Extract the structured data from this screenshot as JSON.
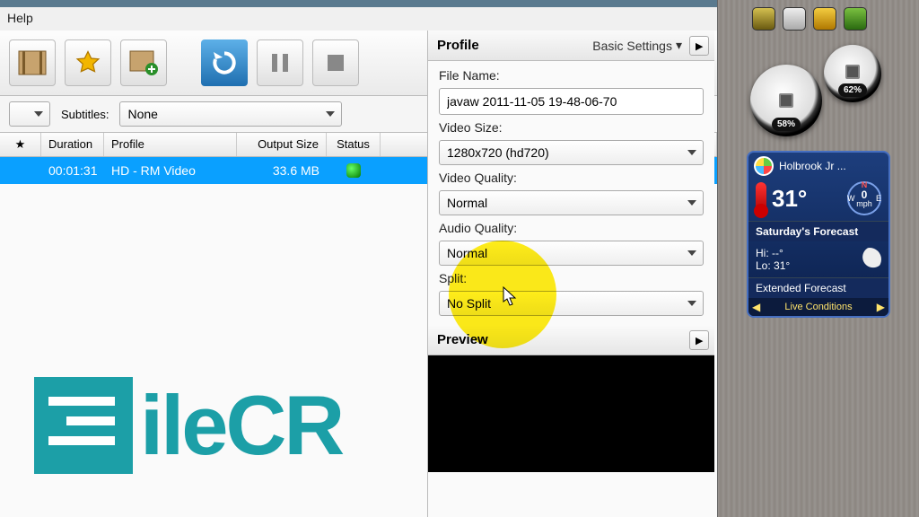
{
  "menu": {
    "help": "Help"
  },
  "toolbar": {
    "icons": [
      "film-icon",
      "favorite-icon",
      "add-video-icon",
      "refresh-icon",
      "pause-icon",
      "stop-icon"
    ]
  },
  "formatbar": {
    "subtitles_label": "Subtitles:",
    "subtitles_value": "None"
  },
  "list": {
    "headers": {
      "star": "★",
      "duration": "Duration",
      "profile": "Profile",
      "output_size": "Output Size",
      "status": "Status"
    },
    "rows": [
      {
        "duration": "00:01:31",
        "profile": "HD - RM Video",
        "output_size": "33.6 MB",
        "status": "ok"
      }
    ]
  },
  "settings": {
    "title": "Profile",
    "basic_link": "Basic Settings",
    "file_name_label": "File Name:",
    "file_name_value": "javaw 2011-11-05 19-48-06-70",
    "video_size_label": "Video Size:",
    "video_size_value": "1280x720 (hd720)",
    "video_quality_label": "Video Quality:",
    "video_quality_value": "Normal",
    "audio_quality_label": "Audio Quality:",
    "audio_quality_value": "Normal",
    "split_label": "Split:",
    "split_value": "No Split",
    "preview_title": "Preview"
  },
  "sidebar": {
    "gauges": {
      "cpu_pct": "58%",
      "ram_pct": "62%"
    },
    "weather": {
      "location": "Holbrook Jr ...",
      "temp": "31°",
      "wind_val": "0",
      "wind_unit": "mph",
      "forecast_title": "Saturday's Forecast",
      "hi_label": "Hi:",
      "hi_val": "--°",
      "lo_label": "Lo:",
      "lo_val": "31°",
      "extended": "Extended Forecast",
      "live": "Live Conditions"
    }
  },
  "watermark": {
    "text": "ileCR"
  }
}
